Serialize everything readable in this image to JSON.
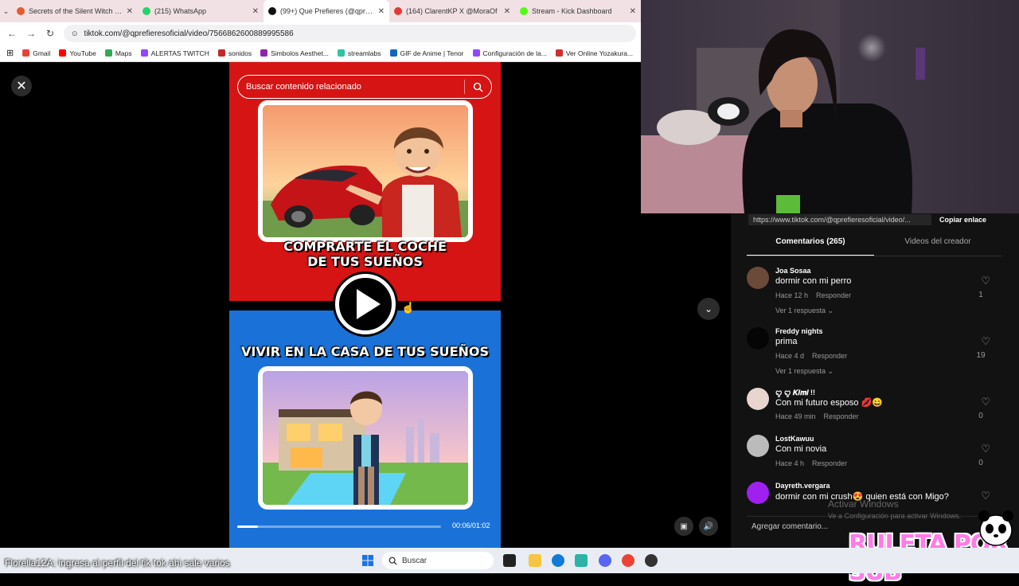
{
  "browser": {
    "tabs": [
      {
        "title": "Secrets of the Silent Witch Mor",
        "color": "#e85b2c"
      },
      {
        "title": "(215) WhatsApp",
        "color": "#25d366"
      },
      {
        "title": "(99+) Que Prefieres (@qprefieres",
        "color": "#111111"
      },
      {
        "title": "(164) ClarentKP X @MoraOf",
        "color": "#e53935"
      },
      {
        "title": "Stream - Kick Dashboard",
        "color": "#53fc18"
      }
    ],
    "url": "tiktok.com/@qprefieresoficial/video/7566862600889995586",
    "bookmarks": [
      {
        "label": "Gmail",
        "color": "#ea4335"
      },
      {
        "label": "YouTube",
        "color": "#ff0000"
      },
      {
        "label": "Maps",
        "color": "#34a853"
      },
      {
        "label": "ALERTAS TWITCH",
        "color": "#9146ff"
      },
      {
        "label": "sonidos",
        "color": "#c62828"
      },
      {
        "label": "Simbolos Aesthet...",
        "color": "#8e24aa"
      },
      {
        "label": "streamlabs",
        "color": "#31c3a2"
      },
      {
        "label": "GIF de Anime | Tenor",
        "color": "#1565c0"
      },
      {
        "label": "Configuración de la...",
        "color": "#9146ff"
      },
      {
        "label": "Ver Online Yozakura...",
        "color": "#d32f2f"
      }
    ]
  },
  "video": {
    "search_placeholder": "Buscar contenido relacionado",
    "caption_top_line1": "COMPRARTE EL COCHE",
    "caption_top_line2": "DE TUS SUEÑOS",
    "caption_bottom": "VIVIR EN LA CASA DE TUS SUEÑOS",
    "time": "00:06/01:02",
    "progress": 0.1
  },
  "panel": {
    "share_url": "https://www.tiktok.com/@qprefieresoficial/video/...",
    "copy_link": "Copiar enlace",
    "tab_comments": "Comentarios (265)",
    "tab_videos": "Videos del creador",
    "comments": [
      {
        "user": "Joa Sosaa",
        "text": "dormir con mi perro",
        "time": "Hace 12 h",
        "reply": "Responder",
        "replies": "Ver 1 respuesta",
        "likes": "1",
        "avatar": "#6b4a3a"
      },
      {
        "user": "Freddy nights",
        "text": "prima",
        "time": "Hace 4 d",
        "reply": "Responder",
        "replies": "Ver 1 respuesta",
        "likes": "19",
        "avatar": "#050505"
      },
      {
        "user": "ꨄ︎ ꨄ︎ 𝑲𝒊𝒎𝒊 !!",
        "text": "Con mi futuro esposo 💋😄",
        "time": "Hace 49 min",
        "reply": "Responder",
        "replies": "",
        "likes": "0",
        "avatar": "#e8d5d0"
      },
      {
        "user": "LostKawuu",
        "text": "Con mi novia",
        "time": "Hace 4 h",
        "reply": "Responder",
        "replies": "",
        "likes": "0",
        "avatar": "#bbbbbb"
      },
      {
        "user": "Dayreth.vergara",
        "text": "dormir con mi crush😍 quien está con Migo?",
        "time": "",
        "reply": "",
        "replies": "",
        "likes": "",
        "avatar": "#a020f0"
      }
    ],
    "add_comment": "Agregar comentario...",
    "watermark": "Activar Windows",
    "watermark_sub": "Ve a Configuración para activar Windows."
  },
  "overlay": {
    "ruleta": "RULETA POR SUB",
    "chat_user": "Florella12A",
    "chat_text": ": ingresa al perfil del tik tok ahi sale varios"
  },
  "taskbar": {
    "search_label": "Buscar"
  }
}
